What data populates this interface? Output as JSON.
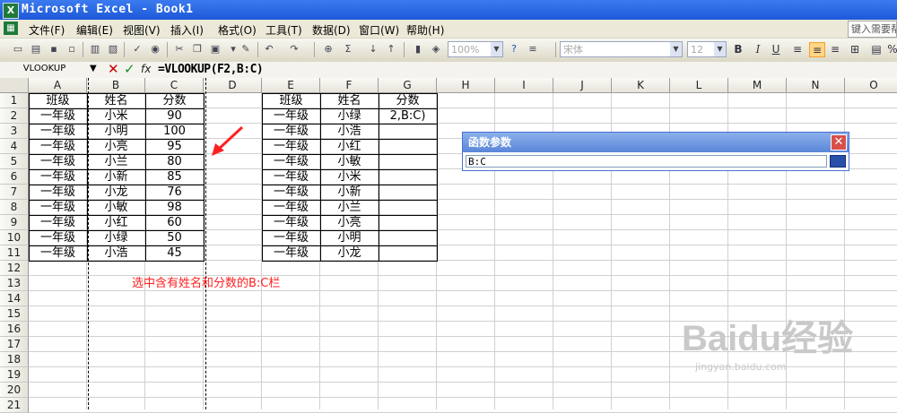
{
  "window": {
    "title": "Microsoft Excel - Book1",
    "app_icon_letter": "X"
  },
  "menu": {
    "items": [
      "文件(F)",
      "编辑(E)",
      "视图(V)",
      "插入(I)",
      "格式(O)",
      "工具(T)",
      "数据(D)",
      "窗口(W)",
      "帮助(H)"
    ],
    "help_search_placeholder": "键入需要帮"
  },
  "toolbar": {
    "zoom": "100%",
    "font_name": "宋体",
    "font_size": "12",
    "bold": "B",
    "italic": "I",
    "underline": "U"
  },
  "formula_bar": {
    "name_box": "VLOOKUP",
    "formula": "=VLOOKUP(F2,B:C)",
    "fx_label": "fx"
  },
  "columns": [
    "A",
    "B",
    "C",
    "D",
    "E",
    "F",
    "G",
    "H",
    "I",
    "J",
    "K",
    "L",
    "M",
    "N",
    "O"
  ],
  "rows": [
    "1",
    "2",
    "3",
    "4",
    "5",
    "6",
    "7",
    "8",
    "9",
    "10",
    "11",
    "12",
    "13",
    "14",
    "15",
    "16",
    "17",
    "18",
    "19",
    "20",
    "21"
  ],
  "table_left": {
    "headers": [
      "班级",
      "姓名",
      "分数"
    ],
    "rows": [
      [
        "一年级",
        "小米",
        "90"
      ],
      [
        "一年级",
        "小明",
        "100"
      ],
      [
        "一年级",
        "小亮",
        "95"
      ],
      [
        "一年级",
        "小兰",
        "80"
      ],
      [
        "一年级",
        "小新",
        "85"
      ],
      [
        "一年级",
        "小龙",
        "76"
      ],
      [
        "一年级",
        "小敏",
        "98"
      ],
      [
        "一年级",
        "小红",
        "60"
      ],
      [
        "一年级",
        "小绿",
        "50"
      ],
      [
        "一年级",
        "小浩",
        "45"
      ]
    ]
  },
  "table_right": {
    "headers": [
      "班级",
      "姓名",
      "分数"
    ],
    "rows": [
      [
        "一年级",
        "小绿",
        "2,B:C)"
      ],
      [
        "一年级",
        "小浩",
        ""
      ],
      [
        "一年级",
        "小红",
        ""
      ],
      [
        "一年级",
        "小敏",
        ""
      ],
      [
        "一年级",
        "小米",
        ""
      ],
      [
        "一年级",
        "小新",
        ""
      ],
      [
        "一年级",
        "小兰",
        ""
      ],
      [
        "一年级",
        "小亮",
        ""
      ],
      [
        "一年级",
        "小明",
        ""
      ],
      [
        "一年级",
        "小龙",
        ""
      ]
    ]
  },
  "dialog": {
    "title": "函数参数",
    "input_value": "B:C"
  },
  "annotation": {
    "text": "选中含有姓名和分数的B:C栏",
    "color": "#ff2020"
  },
  "watermark": {
    "logo": "Baidu经验",
    "url": "jingyan.baidu.com"
  },
  "colors": {
    "title_bar": "#1d58d8",
    "menu_bg": "#ece9d8",
    "selection_outline": "#000000",
    "dialog_header": "#5a86d8"
  }
}
